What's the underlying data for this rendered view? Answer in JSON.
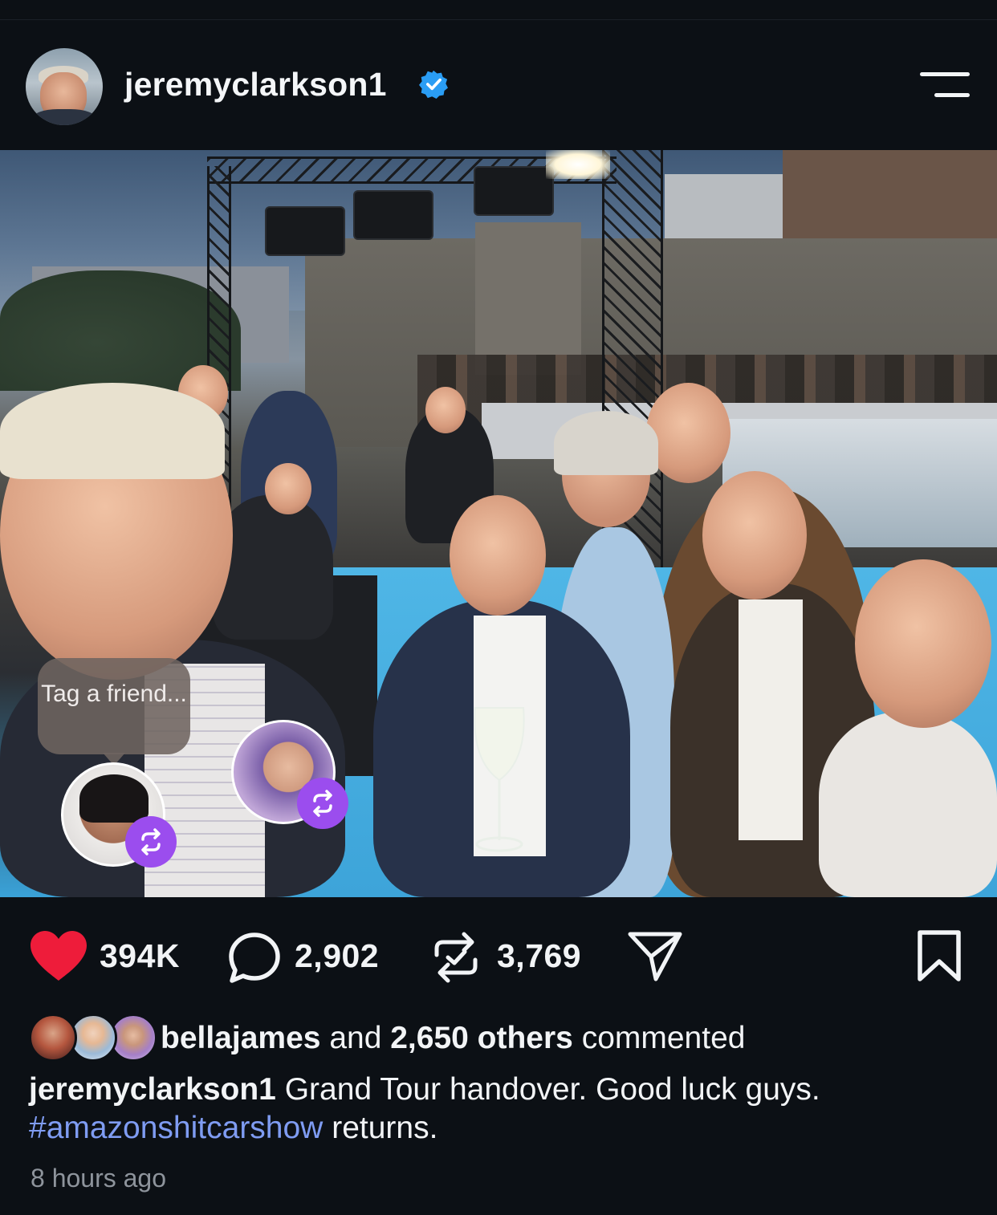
{
  "post": {
    "username": "jeremyclarkson1",
    "photo_overlay": {
      "tag_prompt": "Tag a friend..."
    }
  },
  "actions": {
    "likes": "394K",
    "comments": "2,902",
    "reposts": "3,769"
  },
  "comments_summary": {
    "first_user": "bellajames",
    "and_text": "and",
    "others_count": "2,650 others",
    "suffix": "commented"
  },
  "caption": {
    "username": "jeremyclarkson1",
    "text": "Grand Tour handover. Good luck guys.",
    "hashtag": "#amazonshitcarshow",
    "after_hashtag": "returns."
  },
  "timestamp": "8 hours ago",
  "colors": {
    "background": "#0c1015",
    "like_heart": "#ee1c3a",
    "verified_badge": "#2a9df4",
    "hashtag": "#7f9cf2",
    "repost_badge": "#9b4dee"
  },
  "icons": [
    "verified-badge-icon",
    "menu-icon",
    "heart-icon",
    "comment-icon",
    "repost-icon",
    "share-icon",
    "bookmark-icon"
  ]
}
